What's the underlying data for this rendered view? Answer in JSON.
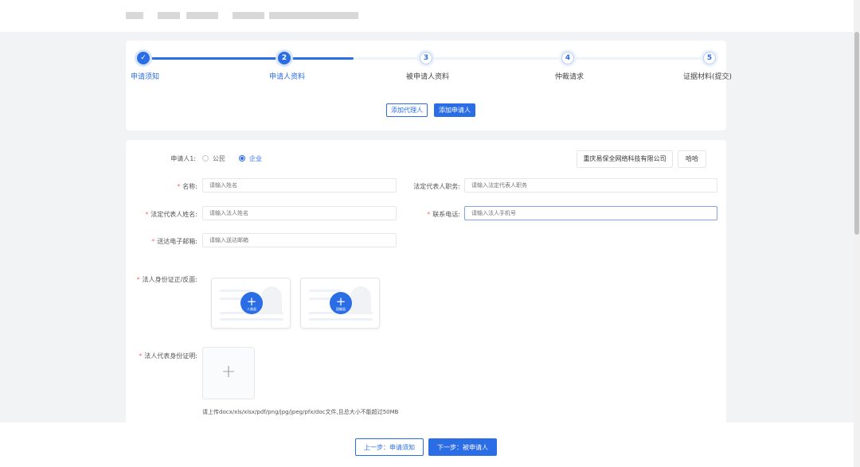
{
  "steps": [
    {
      "number": "✓",
      "label": "申请须知",
      "state": "done"
    },
    {
      "number": "2",
      "label": "申请人资料",
      "state": "active"
    },
    {
      "number": "3",
      "label": "被申请人资料",
      "state": "todo"
    },
    {
      "number": "4",
      "label": "仲裁请求",
      "state": "todo"
    },
    {
      "number": "5",
      "label": "证据材料(提交)",
      "state": "todo"
    }
  ],
  "actions": {
    "add_agent": "添加代理人",
    "add_applicant": "添加申请人"
  },
  "applicant": {
    "label": "申请人1:",
    "type_options": [
      "公民",
      "企业"
    ],
    "selected_type": "企业",
    "tags": [
      "重庆易保全网络科技有限公司",
      "哈哈"
    ]
  },
  "fields": {
    "name": {
      "label": "名称:",
      "placeholder": "请输入姓名"
    },
    "legal_rep_title": {
      "label": "法定代表人职务:",
      "placeholder": "请输入法定代表人职务"
    },
    "legal_rep_name": {
      "label": "法定代表人姓名:",
      "placeholder": "请输入法人姓名"
    },
    "phone": {
      "label": "联系电话:",
      "placeholder": "请输入法人手机号"
    },
    "email": {
      "label": "送达电子邮箱:",
      "placeholder": "请输入送达邮箱"
    }
  },
  "uploads": {
    "id_card_label": "法人身份证正/反面:",
    "id_front": "人像面",
    "id_back": "国徽面",
    "cert_label": "法人代表身份证明:",
    "hint": "请上传docx/xls/xlsx/pdf/png/jpg/jpeg/pfx/doc文件,且总大小不能超过50MB"
  },
  "footer": {
    "prev": "上一步：申请须知",
    "next": "下一步：被申请人"
  },
  "colors": {
    "primary": "#2b6de5",
    "required": "#f56c6c"
  }
}
